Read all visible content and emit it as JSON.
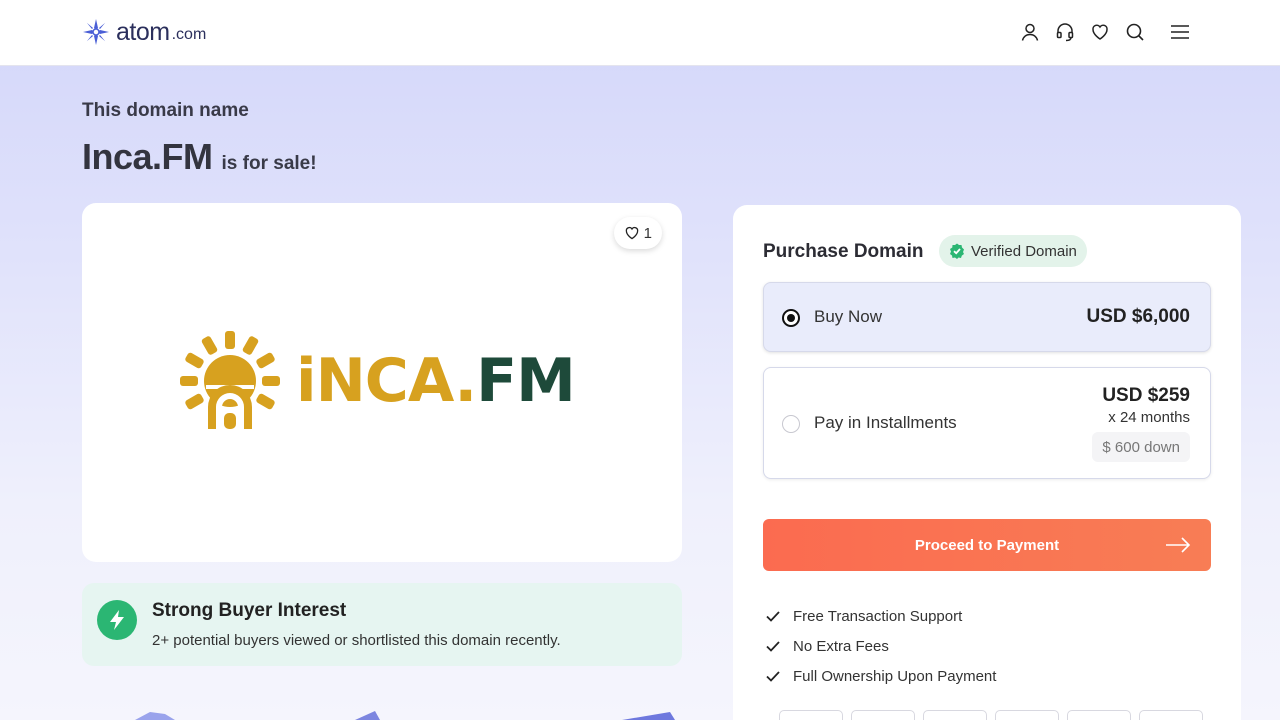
{
  "header": {
    "brand": "atom",
    "brand_suffix": ".com",
    "icons": [
      "user-icon",
      "headset-icon",
      "heart-icon",
      "search-icon",
      "menu-icon"
    ]
  },
  "hero": {
    "pre_title": "This domain name",
    "domain": "Inca.FM",
    "for_sale": "is for sale!"
  },
  "logo_card": {
    "likes": "1",
    "brand_gold": "iNCA.",
    "brand_green": "FM"
  },
  "interest": {
    "title": "Strong Buyer Interest",
    "subtitle": "2+ potential buyers viewed or shortlisted this domain recently."
  },
  "purchase": {
    "title": "Purchase Domain",
    "verified": "Verified Domain",
    "buy_now": {
      "label": "Buy Now",
      "price": "USD $6,000",
      "selected": true
    },
    "installments": {
      "label": "Pay in Installments",
      "price": "USD $259",
      "months": "x 24 months",
      "down": "$ 600 down",
      "selected": false
    },
    "proceed": "Proceed to Payment",
    "features": [
      "Free Transaction Support",
      "No Extra Fees",
      "Full Ownership Upon Payment"
    ]
  },
  "colors": {
    "accent": "#fb6b50",
    "verified_green": "#2bb673",
    "brand_gold": "#d7a11f",
    "brand_green": "#1e4a3a",
    "logo_blue": "#4a5fd6"
  }
}
